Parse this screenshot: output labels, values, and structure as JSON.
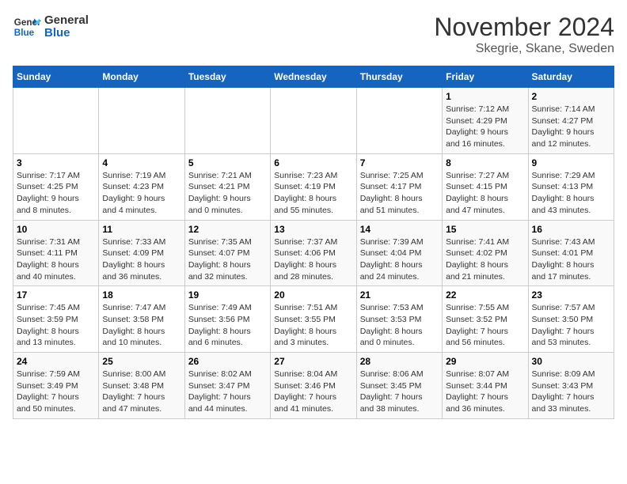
{
  "header": {
    "logo_general": "General",
    "logo_blue": "Blue",
    "month": "November 2024",
    "location": "Skegrie, Skane, Sweden"
  },
  "weekdays": [
    "Sunday",
    "Monday",
    "Tuesday",
    "Wednesday",
    "Thursday",
    "Friday",
    "Saturday"
  ],
  "weeks": [
    [
      {
        "day": "",
        "info": ""
      },
      {
        "day": "",
        "info": ""
      },
      {
        "day": "",
        "info": ""
      },
      {
        "day": "",
        "info": ""
      },
      {
        "day": "",
        "info": ""
      },
      {
        "day": "1",
        "info": "Sunrise: 7:12 AM\nSunset: 4:29 PM\nDaylight: 9 hours\nand 16 minutes."
      },
      {
        "day": "2",
        "info": "Sunrise: 7:14 AM\nSunset: 4:27 PM\nDaylight: 9 hours\nand 12 minutes."
      }
    ],
    [
      {
        "day": "3",
        "info": "Sunrise: 7:17 AM\nSunset: 4:25 PM\nDaylight: 9 hours\nand 8 minutes."
      },
      {
        "day": "4",
        "info": "Sunrise: 7:19 AM\nSunset: 4:23 PM\nDaylight: 9 hours\nand 4 minutes."
      },
      {
        "day": "5",
        "info": "Sunrise: 7:21 AM\nSunset: 4:21 PM\nDaylight: 9 hours\nand 0 minutes."
      },
      {
        "day": "6",
        "info": "Sunrise: 7:23 AM\nSunset: 4:19 PM\nDaylight: 8 hours\nand 55 minutes."
      },
      {
        "day": "7",
        "info": "Sunrise: 7:25 AM\nSunset: 4:17 PM\nDaylight: 8 hours\nand 51 minutes."
      },
      {
        "day": "8",
        "info": "Sunrise: 7:27 AM\nSunset: 4:15 PM\nDaylight: 8 hours\nand 47 minutes."
      },
      {
        "day": "9",
        "info": "Sunrise: 7:29 AM\nSunset: 4:13 PM\nDaylight: 8 hours\nand 43 minutes."
      }
    ],
    [
      {
        "day": "10",
        "info": "Sunrise: 7:31 AM\nSunset: 4:11 PM\nDaylight: 8 hours\nand 40 minutes."
      },
      {
        "day": "11",
        "info": "Sunrise: 7:33 AM\nSunset: 4:09 PM\nDaylight: 8 hours\nand 36 minutes."
      },
      {
        "day": "12",
        "info": "Sunrise: 7:35 AM\nSunset: 4:07 PM\nDaylight: 8 hours\nand 32 minutes."
      },
      {
        "day": "13",
        "info": "Sunrise: 7:37 AM\nSunset: 4:06 PM\nDaylight: 8 hours\nand 28 minutes."
      },
      {
        "day": "14",
        "info": "Sunrise: 7:39 AM\nSunset: 4:04 PM\nDaylight: 8 hours\nand 24 minutes."
      },
      {
        "day": "15",
        "info": "Sunrise: 7:41 AM\nSunset: 4:02 PM\nDaylight: 8 hours\nand 21 minutes."
      },
      {
        "day": "16",
        "info": "Sunrise: 7:43 AM\nSunset: 4:01 PM\nDaylight: 8 hours\nand 17 minutes."
      }
    ],
    [
      {
        "day": "17",
        "info": "Sunrise: 7:45 AM\nSunset: 3:59 PM\nDaylight: 8 hours\nand 13 minutes."
      },
      {
        "day": "18",
        "info": "Sunrise: 7:47 AM\nSunset: 3:58 PM\nDaylight: 8 hours\nand 10 minutes."
      },
      {
        "day": "19",
        "info": "Sunrise: 7:49 AM\nSunset: 3:56 PM\nDaylight: 8 hours\nand 6 minutes."
      },
      {
        "day": "20",
        "info": "Sunrise: 7:51 AM\nSunset: 3:55 PM\nDaylight: 8 hours\nand 3 minutes."
      },
      {
        "day": "21",
        "info": "Sunrise: 7:53 AM\nSunset: 3:53 PM\nDaylight: 8 hours\nand 0 minutes."
      },
      {
        "day": "22",
        "info": "Sunrise: 7:55 AM\nSunset: 3:52 PM\nDaylight: 7 hours\nand 56 minutes."
      },
      {
        "day": "23",
        "info": "Sunrise: 7:57 AM\nSunset: 3:50 PM\nDaylight: 7 hours\nand 53 minutes."
      }
    ],
    [
      {
        "day": "24",
        "info": "Sunrise: 7:59 AM\nSunset: 3:49 PM\nDaylight: 7 hours\nand 50 minutes."
      },
      {
        "day": "25",
        "info": "Sunrise: 8:00 AM\nSunset: 3:48 PM\nDaylight: 7 hours\nand 47 minutes."
      },
      {
        "day": "26",
        "info": "Sunrise: 8:02 AM\nSunset: 3:47 PM\nDaylight: 7 hours\nand 44 minutes."
      },
      {
        "day": "27",
        "info": "Sunrise: 8:04 AM\nSunset: 3:46 PM\nDaylight: 7 hours\nand 41 minutes."
      },
      {
        "day": "28",
        "info": "Sunrise: 8:06 AM\nSunset: 3:45 PM\nDaylight: 7 hours\nand 38 minutes."
      },
      {
        "day": "29",
        "info": "Sunrise: 8:07 AM\nSunset: 3:44 PM\nDaylight: 7 hours\nand 36 minutes."
      },
      {
        "day": "30",
        "info": "Sunrise: 8:09 AM\nSunset: 3:43 PM\nDaylight: 7 hours\nand 33 minutes."
      }
    ]
  ]
}
